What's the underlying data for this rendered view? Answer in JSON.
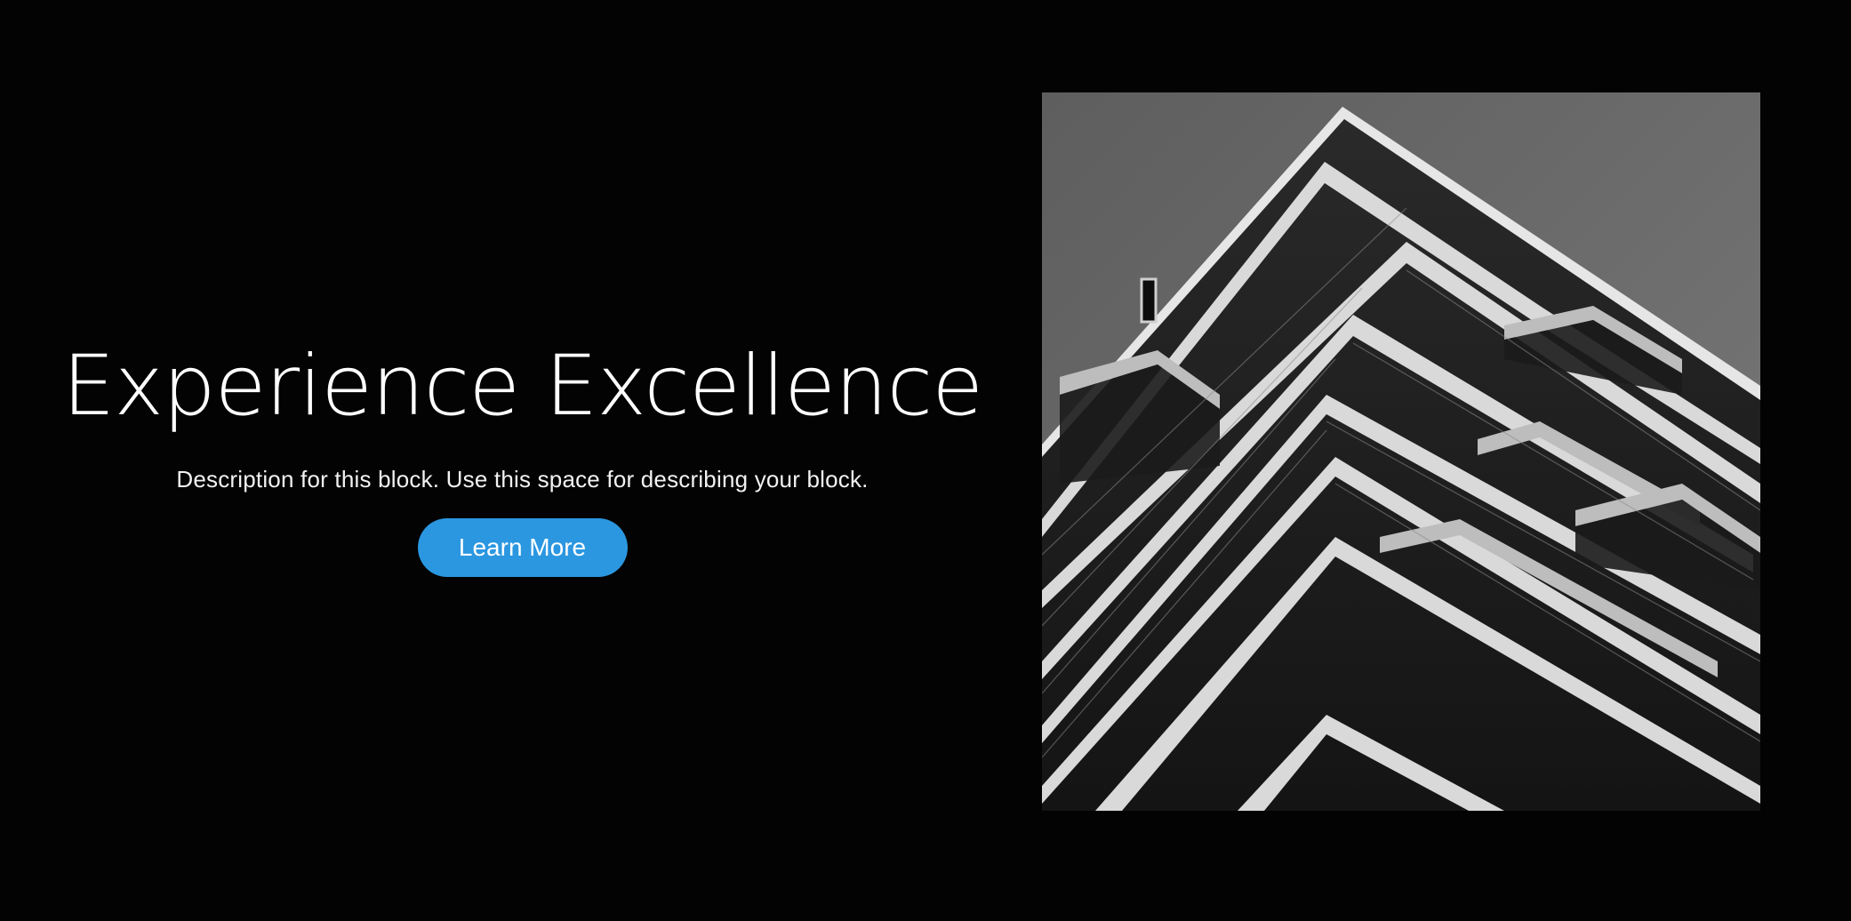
{
  "hero": {
    "title": "Experience Excellence",
    "description": "Description for this block. Use this space for describing your block.",
    "button_label": "Learn More"
  },
  "image": {
    "subject": "building-photo"
  },
  "colors": {
    "background": "#030303",
    "accent": "#2b97e1",
    "text": "#ffffff"
  }
}
